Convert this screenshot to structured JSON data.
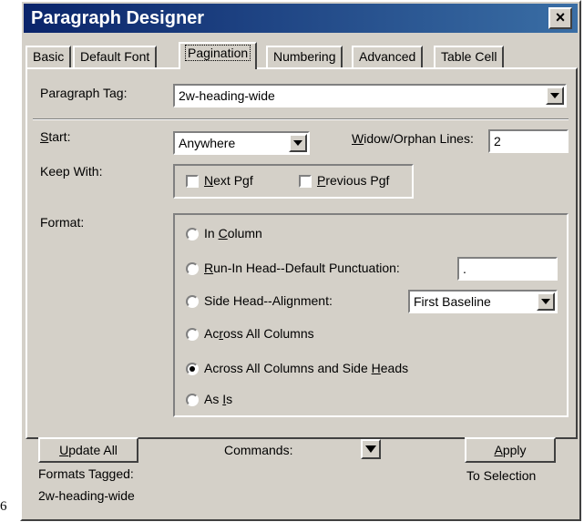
{
  "stray_char": "6",
  "window": {
    "title": "Paragraph Designer",
    "close_glyph": "×"
  },
  "tabs": [
    "Basic",
    "Default Font",
    "Pagination",
    "Numbering",
    "Advanced",
    "Table Cell"
  ],
  "active_tab": "Pagination",
  "paragraph_tag": {
    "label": "Paragraph Tag:",
    "value": "2w-heading-wide"
  },
  "start": {
    "label": "Start:",
    "value": "Anywhere"
  },
  "widow": {
    "label": "Widow/Orphan Lines:",
    "value": "2"
  },
  "keep_with": {
    "label": "Keep With:",
    "next": "Next Pgf",
    "previous": "Previous Pgf",
    "next_checked": false,
    "previous_checked": false
  },
  "format": {
    "label": "Format:",
    "options": {
      "in_column": "In Column",
      "run_in": "Run-In Head--Default Punctuation:",
      "side_head": "Side Head--Alignment:",
      "across_all": "Across All Columns",
      "across_all_side": "Across All Columns and Side Heads",
      "as_is": "As Is"
    },
    "selected": "across_all_side",
    "run_in_value": ".",
    "side_head_alignment": "First Baseline"
  },
  "footer": {
    "update_all": "Update All",
    "formats_tagged": "Formats Tagged:",
    "formats_tag_value": "2w-heading-wide",
    "commands": "Commands:",
    "apply": "Apply",
    "to_selection": "To Selection"
  }
}
